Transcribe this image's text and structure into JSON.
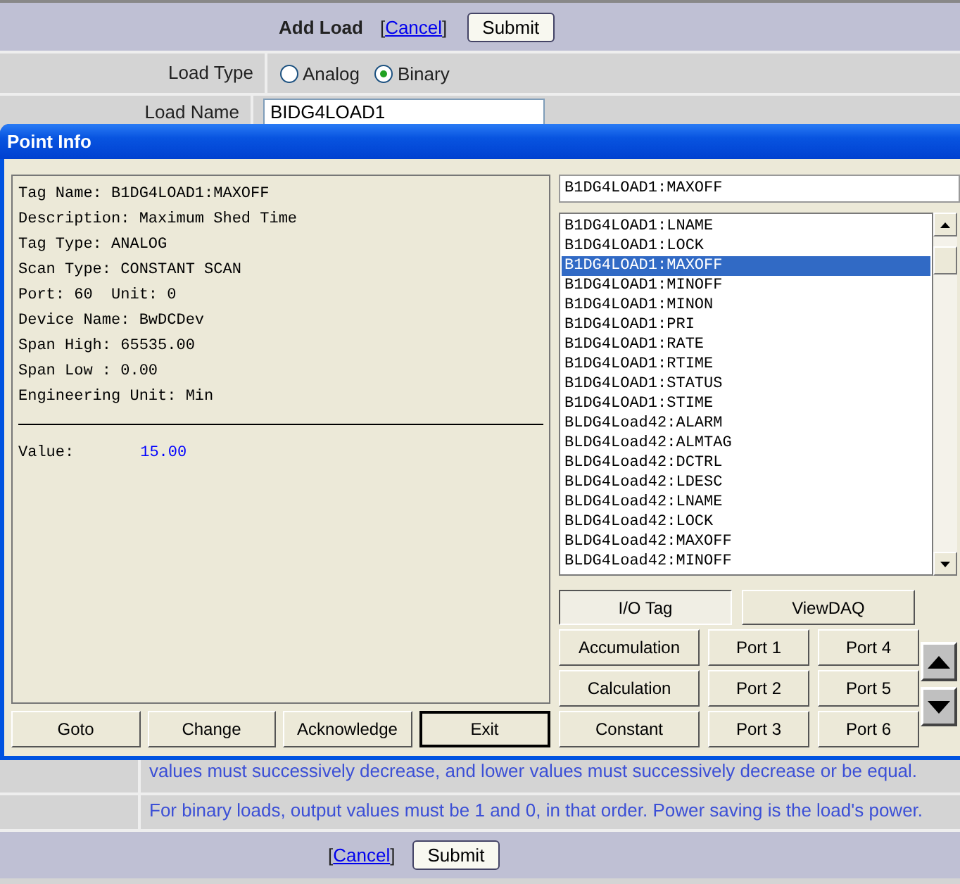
{
  "form": {
    "title": "Add Load",
    "cancel": {
      "before": "[",
      "link": "Cancel",
      "after": "]"
    },
    "submit": "Submit",
    "load_type": {
      "label": "Load Type",
      "options": [
        {
          "label": "Analog",
          "selected": false
        },
        {
          "label": "Binary",
          "selected": true
        }
      ]
    },
    "load_name": {
      "label": "Load Name",
      "value": "BIDG4LOAD1"
    },
    "notes": [
      "values must successively decrease, and lower values must successively decrease or be equal.",
      "For binary loads, output values must be 1 and 0, in that order. Power saving is the load's power."
    ],
    "footer": {
      "cancel": {
        "before": "[",
        "link": "Cancel",
        "after": "]"
      },
      "submit": "Submit"
    }
  },
  "dialog": {
    "title": "Point Info",
    "info_lines": [
      "Tag Name: B1DG4LOAD1:MAXOFF",
      "Description: Maximum Shed Time",
      "Tag Type: ANALOG",
      "Scan Type: CONSTANT SCAN",
      "Port: 60  Unit: 0",
      "Device Name: BwDCDev",
      "Span High: 65535.00",
      "Span Low : 0.00",
      "Engineering Unit: Min"
    ],
    "value": {
      "label": "Value:",
      "value": "15.00"
    },
    "tag_field": {
      "value": "B1DG4LOAD1:MAXOFF"
    },
    "tag_list": [
      {
        "label": "B1DG4LOAD1:LNAME",
        "selected": false
      },
      {
        "label": "B1DG4LOAD1:LOCK",
        "selected": false
      },
      {
        "label": "B1DG4LOAD1:MAXOFF",
        "selected": true
      },
      {
        "label": "B1DG4LOAD1:MINOFF",
        "selected": false
      },
      {
        "label": "B1DG4LOAD1:MINON",
        "selected": false
      },
      {
        "label": "B1DG4LOAD1:PRI",
        "selected": false
      },
      {
        "label": "B1DG4LOAD1:RATE",
        "selected": false
      },
      {
        "label": "B1DG4LOAD1:RTIME",
        "selected": false
      },
      {
        "label": "B1DG4LOAD1:STATUS",
        "selected": false
      },
      {
        "label": "B1DG4LOAD1:STIME",
        "selected": false
      },
      {
        "label": "BLDG4Load42:ALARM",
        "selected": false
      },
      {
        "label": "BLDG4Load42:ALMTAG",
        "selected": false
      },
      {
        "label": "BLDG4Load42:DCTRL",
        "selected": false
      },
      {
        "label": "BLDG4Load42:LDESC",
        "selected": false
      },
      {
        "label": "BLDG4Load42:LNAME",
        "selected": false
      },
      {
        "label": "BLDG4Load42:LOCK",
        "selected": false
      },
      {
        "label": "BLDG4Load42:MAXOFF",
        "selected": false
      },
      {
        "label": "BLDG4Load42:MINOFF",
        "selected": false
      }
    ],
    "view_buttons": [
      {
        "label": "I/O Tag",
        "selected": true
      },
      {
        "label": "ViewDAQ",
        "selected": false
      }
    ],
    "type_buttons": [
      "Accumulation",
      "Port 1",
      "Port 4",
      "Calculation",
      "Port 2",
      "Port 5",
      "Constant",
      "Port 3",
      "Port 6"
    ],
    "action_buttons": [
      {
        "label": "Goto",
        "default": false
      },
      {
        "label": "Change",
        "default": false
      },
      {
        "label": "Acknowledge",
        "default": false
      },
      {
        "label": "Exit",
        "default": true
      }
    ]
  }
}
